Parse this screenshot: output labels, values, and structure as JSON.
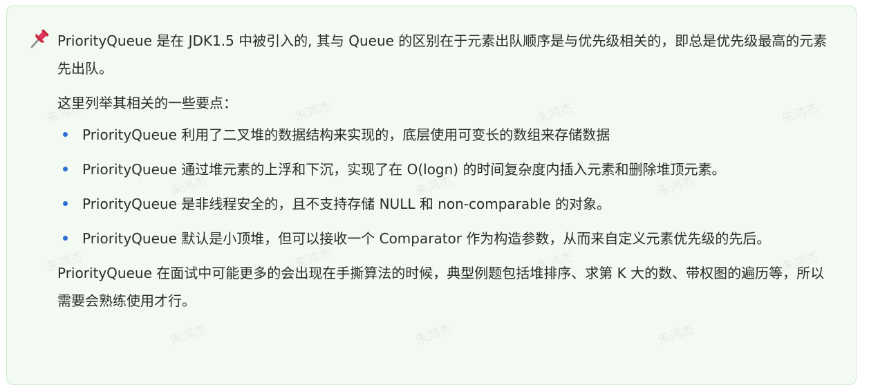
{
  "callout": {
    "icon": "pushpin-icon",
    "accent_color": "#e0345a",
    "background_color": "#f2faf2",
    "intro": "PriorityQueue 是在 JDK1.5 中被引入的, 其与 Queue 的区别在于元素出队顺序是与优先级相关的，即总是优先级最高的元素先出队。",
    "lead": "这里列举其相关的一些要点：",
    "bullet_color": "#2f6fd6",
    "points": [
      "PriorityQueue 利用了二叉堆的数据结构来实现的，底层使用可变长的数组来存储数据",
      "PriorityQueue 通过堆元素的上浮和下沉，实现了在 O(logn) 的时间复杂度内插入元素和删除堆顶元素。",
      "PriorityQueue 是非线程安全的，且不支持存储 NULL 和 non-comparable 的对象。",
      "PriorityQueue 默认是小顶堆，但可以接收一个 Comparator 作为构造参数，从而来自定义元素优先级的先后。"
    ],
    "closing": "PriorityQueue 在面试中可能更多的会出现在手撕算法的时候，典型例题包括堆排序、求第 K 大的数、带权图的遍历等，所以需要会熟练使用才行。"
  },
  "watermark": "朱鸿杰"
}
